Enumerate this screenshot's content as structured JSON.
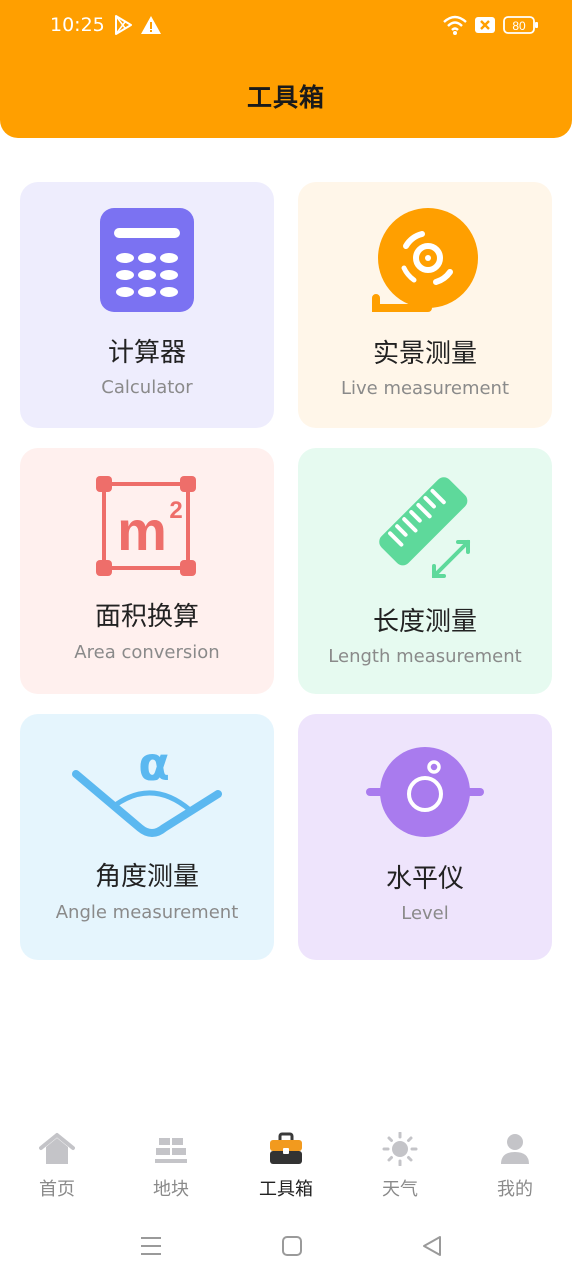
{
  "status_bar": {
    "time": "10:25",
    "battery": "80",
    "icons": [
      "play-store-icon",
      "warning-icon",
      "wifi-icon",
      "no-sim-icon",
      "battery-icon"
    ]
  },
  "header": {
    "title": "工具箱",
    "color": "#FF9F00"
  },
  "tools": [
    {
      "name": "计算器",
      "subtitle": "Calculator",
      "icon": "calculator-icon",
      "bg": "#EEEDFD"
    },
    {
      "name": "实景测量",
      "subtitle": "Live measurement",
      "icon": "tape-measure-icon",
      "bg": "#FFF6E9"
    },
    {
      "name": "面积换算",
      "subtitle": "Area conversion",
      "icon": "area-m2-icon",
      "bg": "#FFF0EE"
    },
    {
      "name": "长度测量",
      "subtitle": "Length measurement",
      "icon": "ruler-icon",
      "bg": "#E6FAF0"
    },
    {
      "name": "角度测量",
      "subtitle": "Angle measurement",
      "icon": "angle-icon",
      "bg": "#E5F5FD"
    },
    {
      "name": "水平仪",
      "subtitle": "Level",
      "icon": "level-icon",
      "bg": "#EEE4FC"
    }
  ],
  "tabbar": {
    "active": "工具箱",
    "items": [
      {
        "label": "首页",
        "icon": "home-icon"
      },
      {
        "label": "地块",
        "icon": "field-icon"
      },
      {
        "label": "工具箱",
        "icon": "toolbox-icon"
      },
      {
        "label": "天气",
        "icon": "sun-icon"
      },
      {
        "label": "我的",
        "icon": "profile-icon"
      }
    ]
  },
  "system_nav": {
    "icons": [
      "menu-icon",
      "home-square-icon",
      "back-triangle-icon"
    ]
  }
}
